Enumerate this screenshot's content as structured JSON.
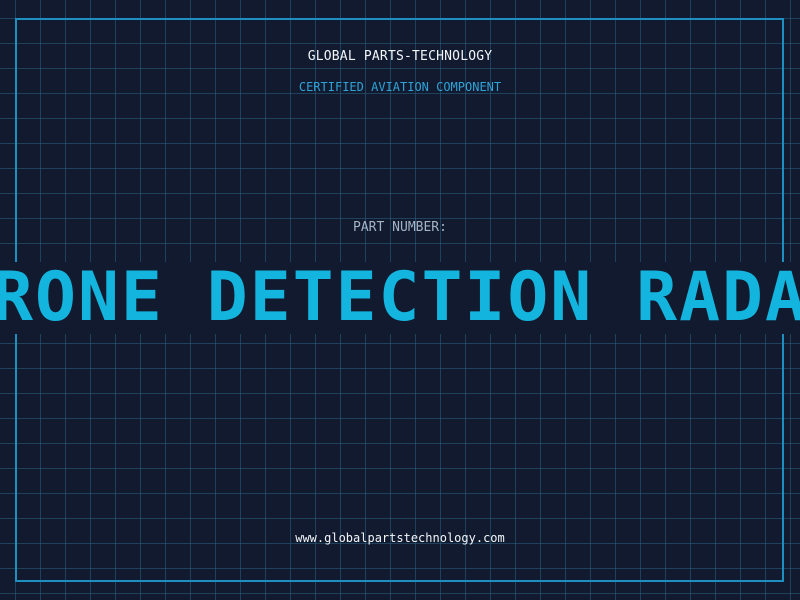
{
  "header": {
    "brand": "GLOBAL PARTS-TECHNOLOGY",
    "subtitle": "CERTIFIED AVIATION COMPONENT"
  },
  "part": {
    "label": "PART NUMBER:",
    "name": "DRONE DETECTION RADAR"
  },
  "footer": {
    "url": "www.globalpartstechnology.com"
  },
  "colors": {
    "background": "#111a2e",
    "grid": "#286082",
    "frame": "#1d8fc0",
    "accent": "#13b4de",
    "subtitle": "#2fa3d8",
    "label": "#a5b3c7",
    "text": "#f2f6fb"
  }
}
